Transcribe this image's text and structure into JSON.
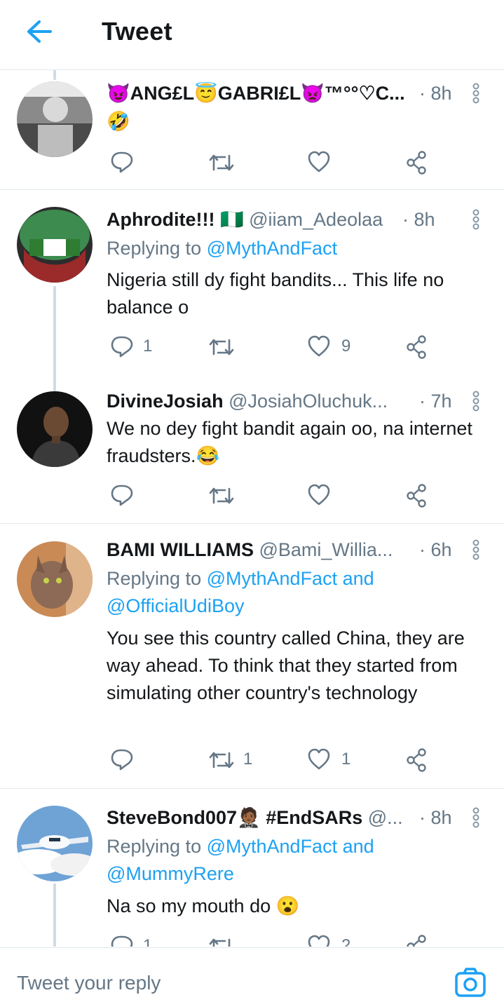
{
  "header": {
    "title": "Tweet",
    "back_icon": "arrow-left-icon",
    "accent": "#1da1f2"
  },
  "tweets": [
    {
      "name": "😈ANG£L😇GABRI£L👿™°°♡C...",
      "handle": "",
      "time": "· 8h",
      "replying_prefix": "",
      "replying_to": "",
      "replying_to_2": "",
      "text": "🤣",
      "reply_count": "",
      "retweet_count": "",
      "like_count": ""
    },
    {
      "name": "Aphrodite!!! 🇳🇬",
      "handle": "@iiam_Adeolaa",
      "time": "· 8h",
      "replying_prefix": "Replying to",
      "replying_to": "@MythAndFact",
      "replying_to_2": "",
      "text": "Nigeria still dy fight bandits... This life no balance o",
      "reply_count": "1",
      "retweet_count": "",
      "like_count": "9"
    },
    {
      "name": "DivineJosiah",
      "handle": "@JosiahOluchuk...",
      "time": "· 7h",
      "replying_prefix": "",
      "replying_to": "",
      "replying_to_2": "",
      "text": "We no dey fight bandit again oo, na internet fraudsters.😂",
      "reply_count": "",
      "retweet_count": "",
      "like_count": ""
    },
    {
      "name": "BAMI WILLIAMS",
      "handle": "@Bami_Willia...",
      "time": "· 6h",
      "replying_prefix": "Replying to",
      "replying_to": "@MythAndFact and",
      "replying_to_2": "@OfficialUdiBoy",
      "text": "You see this country called China, they are way ahead. To think that they started from simulating other country's technology",
      "reply_count": "",
      "retweet_count": "1",
      "like_count": "1"
    },
    {
      "name": "SteveBond007🤵🏾 #EndSARs",
      "handle": "@...",
      "time": "· 8h",
      "replying_prefix": "Replying to",
      "replying_to": "@MythAndFact and",
      "replying_to_2": "@MummyRere",
      "text": "Na so my mouth do 😮",
      "reply_count": "1",
      "retweet_count": "",
      "like_count": "2"
    }
  ],
  "composer": {
    "placeholder": "Tweet your reply",
    "camera_icon": "camera-icon"
  }
}
